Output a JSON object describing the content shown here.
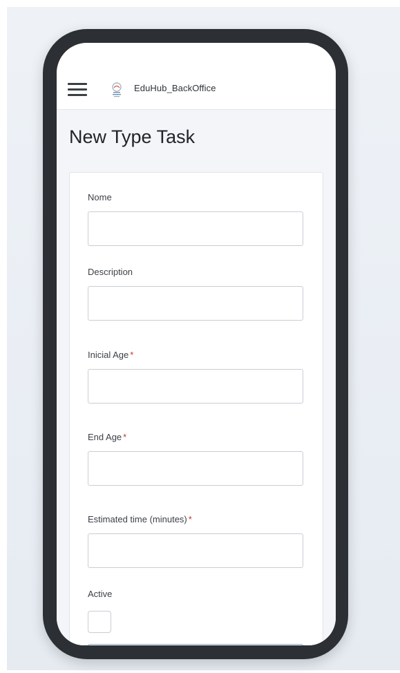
{
  "app": {
    "title": "EduHub_BackOffice",
    "logo_icon": "eduhub-logo-icon",
    "menu_icon": "hamburger-menu-icon"
  },
  "page": {
    "title": "New Type Task"
  },
  "form": {
    "fields": [
      {
        "label": "Nome",
        "required": false,
        "value": ""
      },
      {
        "label": "Description",
        "required": false,
        "value": ""
      },
      {
        "label": "Inicial Age",
        "required": true,
        "value": ""
      },
      {
        "label": "End Age",
        "required": true,
        "value": ""
      },
      {
        "label": "Estimated time (minutes)",
        "required": true,
        "value": ""
      }
    ],
    "active_label": "Active",
    "active_checked": false,
    "required_marker": "*"
  },
  "colors": {
    "accent_required": "#c0392b",
    "phone_frame": "#2c3034",
    "page_background": "#f3f5f8"
  }
}
